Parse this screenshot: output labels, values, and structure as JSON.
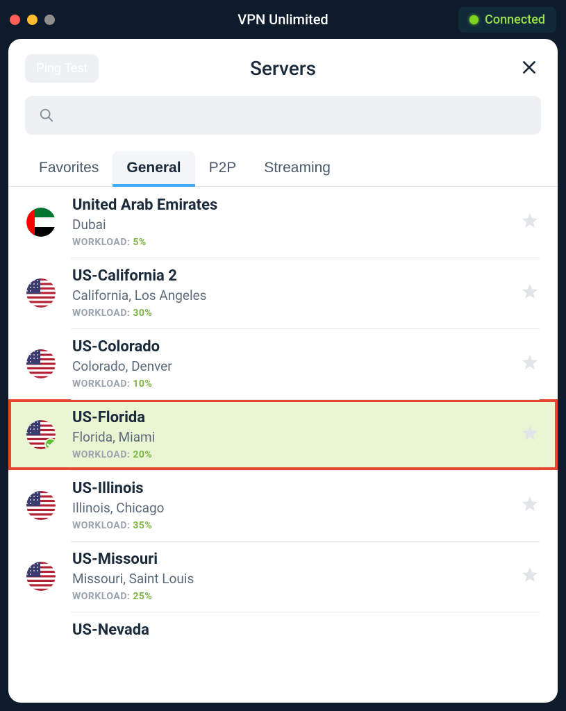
{
  "titlebar": {
    "app_name": "VPN Unlimited",
    "status_label": "Connected"
  },
  "panel": {
    "ping_test_label": "Ping Test",
    "title": "Servers",
    "search_placeholder": ""
  },
  "tabs": [
    {
      "label": "Favorites",
      "active": false
    },
    {
      "label": "General",
      "active": true
    },
    {
      "label": "P2P",
      "active": false
    },
    {
      "label": "Streaming",
      "active": false
    }
  ],
  "workload_label": "WORKLOAD:",
  "servers": [
    {
      "name": "United Arab Emirates",
      "location": "Dubai",
      "workload": "5%",
      "flag": "uae",
      "highlighted": false,
      "connected": false
    },
    {
      "name": "US-California 2",
      "location": "California, Los Angeles",
      "workload": "30%",
      "flag": "us",
      "highlighted": false,
      "connected": false
    },
    {
      "name": "US-Colorado",
      "location": "Colorado, Denver",
      "workload": "10%",
      "flag": "us",
      "highlighted": false,
      "connected": false
    },
    {
      "name": "US-Florida",
      "location": "Florida, Miami",
      "workload": "20%",
      "flag": "us",
      "highlighted": true,
      "connected": true
    },
    {
      "name": "US-Illinois",
      "location": "Illinois, Chicago",
      "workload": "35%",
      "flag": "us",
      "highlighted": false,
      "connected": false
    },
    {
      "name": "US-Missouri",
      "location": "Missouri, Saint Louis",
      "workload": "25%",
      "flag": "us",
      "highlighted": false,
      "connected": false
    }
  ],
  "partial_server": {
    "name": "US-Nevada"
  }
}
